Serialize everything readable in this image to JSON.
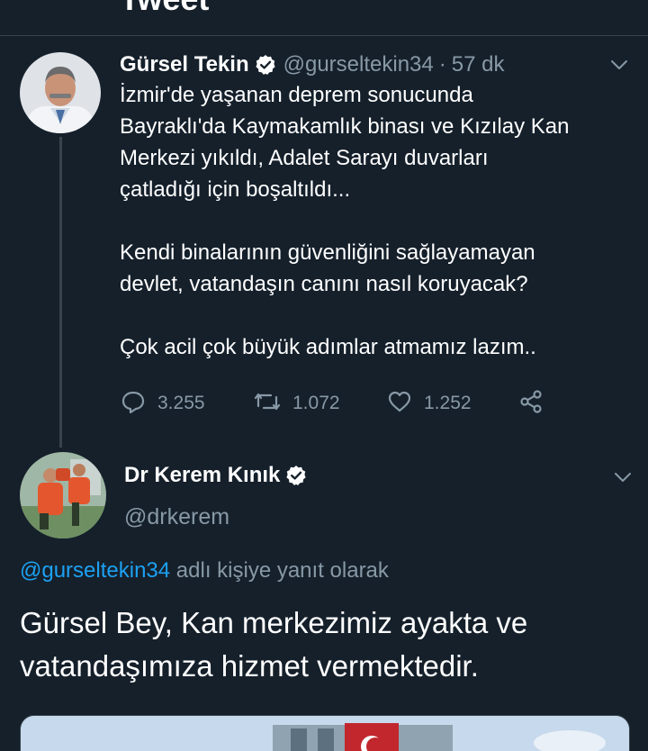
{
  "header": {
    "title": "Tweet"
  },
  "tweet": {
    "author_name": "Gürsel Tekin",
    "handle": "@gurseltekin34",
    "separator": "·",
    "time": "57 dk",
    "text_lines": [
      "İzmir'de yaşanan deprem sonucunda",
      "Bayraklı'da Kaymakamlık binası ve Kızılay Kan",
      "Merkezi yıkıldı, Adalet Sarayı duvarları",
      "çatladığı için boşaltıldı...",
      "",
      "Kendi binalarının güvenliğini sağlayamayan",
      "devlet, vatandaşın canını nasıl koruyacak?",
      "",
      "Çok acil çok büyük adımlar atmamız lazım.."
    ],
    "stats": {
      "replies": "3.255",
      "retweets": "1.072",
      "likes": "1.252"
    },
    "icons": {
      "reply": "reply-icon",
      "retweet": "retweet-icon",
      "like": "heart-icon",
      "share": "share-icon"
    }
  },
  "reply": {
    "author_name": "Dr Kerem Kınık",
    "handle": "@drkerem",
    "replying_to_handle": "@gurseltekin34",
    "replying_to_suffix": " adlı kişiye yanıt olarak",
    "text_lines": [
      "Gürsel Bey, Kan merkezimiz ayakta ve",
      "vatandaşımıza hizmet vermektedir."
    ]
  },
  "colors": {
    "background": "#15202b",
    "text_primary": "#ffffff",
    "text_secondary": "#8899a6",
    "link": "#1da1f2",
    "border": "#38444d"
  }
}
